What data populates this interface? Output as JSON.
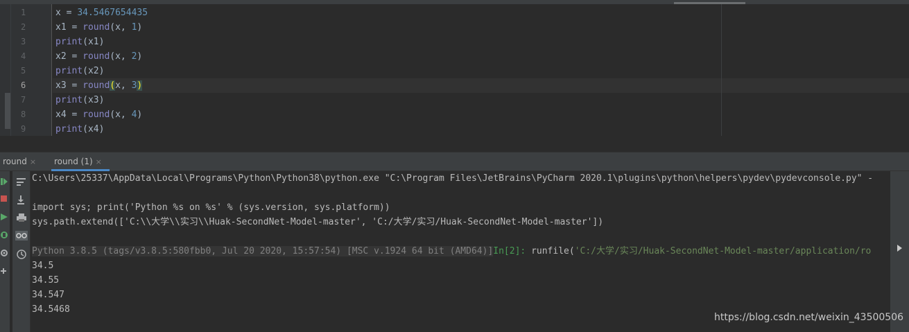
{
  "editor": {
    "lines": [
      {
        "no": "1",
        "tokens": [
          {
            "t": "x",
            "c": "ident"
          },
          {
            "t": " = ",
            "c": "op"
          },
          {
            "t": "34.5467654435",
            "c": "num"
          }
        ]
      },
      {
        "no": "2",
        "tokens": [
          {
            "t": "x1",
            "c": "ident"
          },
          {
            "t": " = ",
            "c": "op"
          },
          {
            "t": "round",
            "c": "fn"
          },
          {
            "t": "(x, ",
            "c": "op"
          },
          {
            "t": "1",
            "c": "num"
          },
          {
            "t": ")",
            "c": "op"
          }
        ]
      },
      {
        "no": "3",
        "tokens": [
          {
            "t": "print",
            "c": "fn"
          },
          {
            "t": "(x1)",
            "c": "op"
          }
        ]
      },
      {
        "no": "4",
        "tokens": [
          {
            "t": "x2",
            "c": "ident"
          },
          {
            "t": " = ",
            "c": "op"
          },
          {
            "t": "round",
            "c": "fn"
          },
          {
            "t": "(x, ",
            "c": "op"
          },
          {
            "t": "2",
            "c": "num"
          },
          {
            "t": ")",
            "c": "op"
          }
        ]
      },
      {
        "no": "5",
        "tokens": [
          {
            "t": "print",
            "c": "fn"
          },
          {
            "t": "(x2)",
            "c": "op"
          }
        ]
      },
      {
        "no": "6",
        "current": true,
        "tokens": [
          {
            "t": "x3",
            "c": "ident"
          },
          {
            "t": " = ",
            "c": "op"
          },
          {
            "t": "round",
            "c": "fn"
          },
          {
            "t": "(",
            "c": "paren-hl"
          },
          {
            "t": "x, ",
            "c": "op"
          },
          {
            "t": "3",
            "c": "num"
          },
          {
            "t": ")",
            "c": "paren-hl"
          }
        ]
      },
      {
        "no": "7",
        "tokens": [
          {
            "t": "print",
            "c": "fn"
          },
          {
            "t": "(x3)",
            "c": "op"
          }
        ]
      },
      {
        "no": "8",
        "tokens": [
          {
            "t": "x4",
            "c": "ident"
          },
          {
            "t": " = ",
            "c": "op"
          },
          {
            "t": "round",
            "c": "fn"
          },
          {
            "t": "(x, ",
            "c": "op"
          },
          {
            "t": "4",
            "c": "num"
          },
          {
            "t": ")",
            "c": "op"
          }
        ]
      },
      {
        "no": "9",
        "tokens": [
          {
            "t": "print",
            "c": "fn"
          },
          {
            "t": "(x4)",
            "c": "op"
          }
        ]
      }
    ]
  },
  "console_tabs": [
    {
      "label": "round",
      "close": "×",
      "active": false
    },
    {
      "label": "round (1)",
      "close": "×",
      "active": true
    }
  ],
  "console": {
    "cmd_line": "C:\\Users\\25337\\AppData\\Local\\Programs\\Python\\Python38\\python.exe \"C:\\Program Files\\JetBrains\\PyCharm 2020.1\\plugins\\python\\helpers\\pydev\\pydevconsole.py\" -",
    "import_line": "import sys; print('Python %s on %s' % (sys.version, sys.platform))",
    "path_line": "sys.path.extend(['C:\\\\大学\\\\实习\\\\Huak-SecondNet-Model-master', 'C:/大学/实习/Huak-SecondNet-Model-master'])",
    "banner": "Python 3.8.5 (tags/v3.8.5:580fbb0, Jul 20 2020, 15:57:54) [MSC v.1924 64 bit (AMD64)]",
    "prompt": "In[2]: ",
    "runfile_call": "runfile(",
    "runfile_arg": "'C:/大学/实习/Huak-SecondNet-Model-master/application/ro",
    "outputs": [
      "34.5",
      "34.55",
      "34.547",
      "34.5468"
    ]
  },
  "watermark": "https://blog.csdn.net/weixin_43500506",
  "colors": {
    "background": "#2b2b2b",
    "number": "#6897bb",
    "builtin": "#8888c6",
    "string": "#6a8759",
    "prompt": "#499c54",
    "tab_underline": "#4a88c7"
  }
}
